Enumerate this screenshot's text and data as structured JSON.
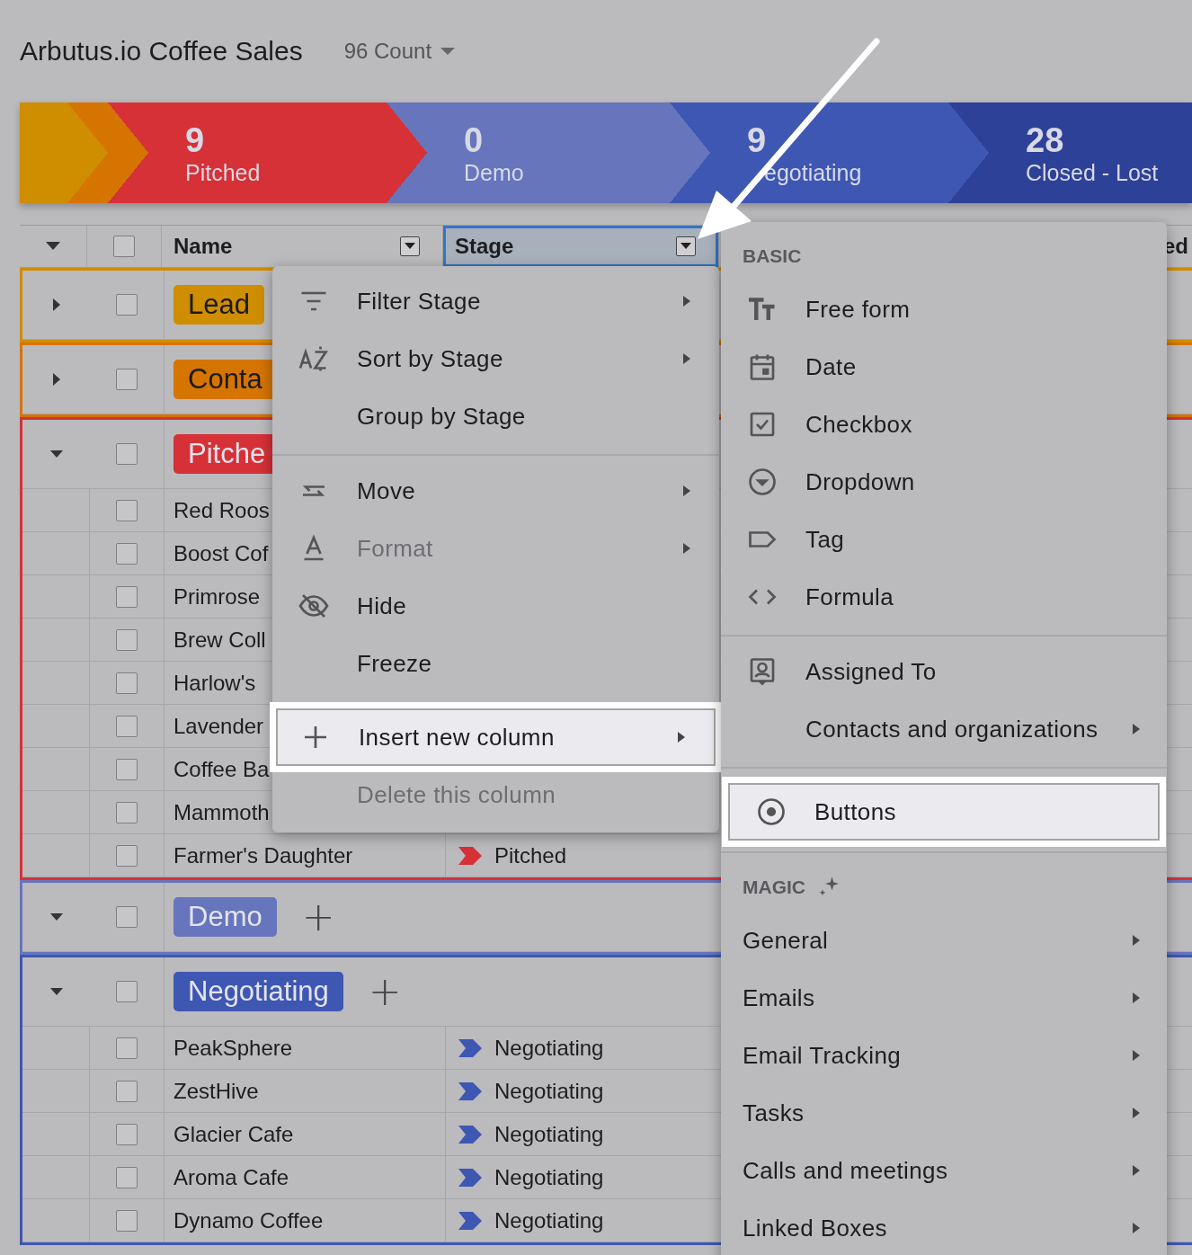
{
  "header": {
    "title": "Arbutus.io Coffee Sales",
    "count": "96 Count"
  },
  "pipeline": [
    {
      "color": "#cf8d00"
    },
    {
      "color": "#d67400"
    },
    {
      "count": "9",
      "label": "Pitched",
      "color": "#d63137"
    },
    {
      "count": "0",
      "label": "Demo",
      "color": "#6675bc"
    },
    {
      "count": "9",
      "label": "egotiating",
      "color": "#3e57b2"
    },
    {
      "count": "28",
      "label": "Closed - Lost",
      "color": "#2d4198"
    }
  ],
  "table": {
    "all_checked": false,
    "columns": [
      {
        "label": "Name",
        "selected": false
      },
      {
        "label": "Stage",
        "selected": true
      },
      {
        "label": "ed",
        "selected": false
      }
    ],
    "groups": [
      {
        "tag": "Lead",
        "color": "#cf8d00",
        "expanded": false,
        "checked": false
      },
      {
        "tag": "Conta",
        "color": "#d67400",
        "expanded": false,
        "checked": false
      },
      {
        "tag": "Pitche",
        "color": "#d63137",
        "expanded": true,
        "checked": false,
        "rows": [
          {
            "name": "Red Roos",
            "checked": false
          },
          {
            "name": "Boost Cof",
            "checked": false
          },
          {
            "name": "Primrose",
            "checked": false
          },
          {
            "name": "Brew Coll",
            "checked": false
          },
          {
            "name": "Harlow's",
            "checked": false
          },
          {
            "name": "Lavender",
            "checked": false
          },
          {
            "name": "Coffee Ba",
            "checked": false
          },
          {
            "name": "Mammoth",
            "checked": false
          },
          {
            "name": "Farmer's Daughter",
            "stage": "Pitched",
            "checked": false
          }
        ]
      },
      {
        "tag": "Demo",
        "color": "#6675bc",
        "expanded": true,
        "checked": false,
        "add": "+"
      },
      {
        "tag": "Negotiating",
        "color": "#3e57b2",
        "expanded": true,
        "checked": false,
        "add": "+",
        "rows": [
          {
            "name": "PeakSphere",
            "stage": "Negotiating",
            "checked": false
          },
          {
            "name": "ZestHive",
            "stage": "Negotiating",
            "checked": false
          },
          {
            "name": "Glacier Cafe",
            "stage": "Negotiating",
            "checked": false
          },
          {
            "name": "Aroma Cafe",
            "stage": "Negotiating",
            "checked": false
          },
          {
            "name": "Dynamo Coffee",
            "stage": "Negotiating",
            "checked": false
          }
        ]
      }
    ]
  },
  "column_menu": {
    "sections": [
      {
        "items": [
          {
            "label": "Filter Stage",
            "has_submenu": true,
            "disabled": false,
            "highlighted": false
          },
          {
            "label": "Sort by Stage",
            "has_submenu": true,
            "disabled": false,
            "highlighted": false
          },
          {
            "label": "Group by Stage",
            "has_submenu": false,
            "disabled": false,
            "highlighted": false
          }
        ]
      },
      {
        "items": [
          {
            "label": "Move",
            "has_submenu": true,
            "disabled": false,
            "highlighted": false
          },
          {
            "label": "Format",
            "has_submenu": true,
            "disabled": true,
            "highlighted": false
          },
          {
            "label": "Hide",
            "has_submenu": false,
            "disabled": false,
            "highlighted": false
          },
          {
            "label": "Freeze",
            "has_submenu": false,
            "disabled": false,
            "highlighted": false
          },
          {
            "label": "Insert new column",
            "has_submenu": true,
            "disabled": false,
            "highlighted": true
          },
          {
            "label": "Delete this column",
            "has_submenu": false,
            "disabled": true,
            "highlighted": false
          }
        ]
      }
    ]
  },
  "type_menu": {
    "sections": [
      {
        "kind": "types",
        "title": "BASIC",
        "items": [
          {
            "label": "Free form",
            "has_submenu": false,
            "highlighted": false
          },
          {
            "label": "Date",
            "has_submenu": false,
            "highlighted": false
          },
          {
            "label": "Checkbox",
            "has_submenu": false,
            "highlighted": false
          },
          {
            "label": "Dropdown",
            "has_submenu": false,
            "highlighted": false
          },
          {
            "label": "Tag",
            "has_submenu": false,
            "highlighted": false
          },
          {
            "label": "Formula",
            "has_submenu": false,
            "highlighted": false
          }
        ]
      },
      {
        "kind": "types",
        "items": [
          {
            "label": "Assigned To",
            "has_submenu": false,
            "highlighted": false
          },
          {
            "label": "Contacts and organizations",
            "has_submenu": true,
            "highlighted": false
          }
        ]
      },
      {
        "kind": "types",
        "items": [
          {
            "label": "Buttons",
            "has_submenu": false,
            "highlighted": true
          }
        ]
      },
      {
        "kind": "magic",
        "title": "MAGIC",
        "items": [
          {
            "label": "General",
            "has_submenu": true,
            "highlighted": false
          },
          {
            "label": "Emails",
            "has_submenu": true,
            "highlighted": false
          },
          {
            "label": "Email Tracking",
            "has_submenu": true,
            "highlighted": false
          },
          {
            "label": "Tasks",
            "has_submenu": true,
            "highlighted": false
          },
          {
            "label": "Calls and meetings",
            "has_submenu": true,
            "highlighted": false
          },
          {
            "label": "Linked Boxes",
            "has_submenu": true,
            "highlighted": false
          }
        ]
      }
    ]
  }
}
